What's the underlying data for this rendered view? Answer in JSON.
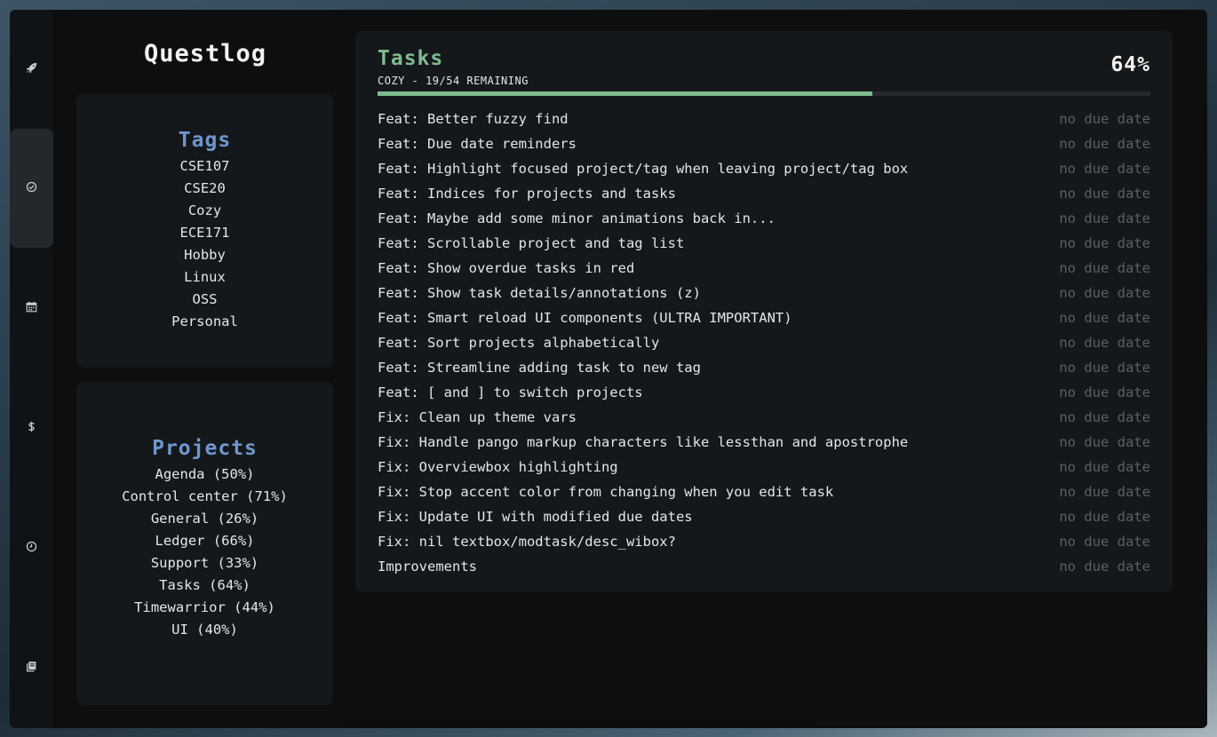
{
  "app": {
    "title": "Questlog"
  },
  "sidebar": {
    "items": [
      {
        "icon": "rocket-icon"
      },
      {
        "icon": "check-circle-icon",
        "active": true
      },
      {
        "icon": "calendar-icon"
      },
      {
        "icon": "dollar-icon"
      },
      {
        "icon": "clock-icon"
      },
      {
        "icon": "journal-icon"
      }
    ]
  },
  "tags": {
    "heading": "Tags",
    "items": [
      "CSE107",
      "CSE20",
      "Cozy",
      "ECE171",
      "Hobby",
      "Linux",
      "OSS",
      "Personal"
    ]
  },
  "projects": {
    "heading": "Projects",
    "items": [
      "Agenda (50%)",
      "Control center (71%)",
      "General (26%)",
      "Ledger (66%)",
      "Support (33%)",
      "Tasks (64%)",
      "Timewarrior (44%)",
      "UI (40%)"
    ]
  },
  "tasks": {
    "title": "Tasks",
    "subtitle": "COZY - 19/54 REMAINING",
    "percent_label": "64%",
    "progress": 0.64,
    "items": [
      {
        "desc": "Feat: Better fuzzy find",
        "due": "no due date"
      },
      {
        "desc": "Feat: Due date reminders",
        "due": "no due date"
      },
      {
        "desc": "Feat: Highlight focused project/tag when leaving project/tag box",
        "due": "no due date"
      },
      {
        "desc": "Feat: Indices for projects and tasks",
        "due": "no due date"
      },
      {
        "desc": "Feat: Maybe add some minor animations back in...",
        "due": "no due date"
      },
      {
        "desc": "Feat: Scrollable project and tag list",
        "due": "no due date"
      },
      {
        "desc": "Feat: Show overdue tasks in red",
        "due": "no due date"
      },
      {
        "desc": "Feat: Show task details/annotations (z)",
        "due": "no due date"
      },
      {
        "desc": "Feat: Smart reload UI components (ULTRA IMPORTANT)",
        "due": "no due date"
      },
      {
        "desc": "Feat: Sort projects alphabetically",
        "due": "no due date"
      },
      {
        "desc": "Feat: Streamline adding task to new tag",
        "due": "no due date"
      },
      {
        "desc": "Feat: [ and ] to switch projects",
        "due": "no due date"
      },
      {
        "desc": "Fix: Clean up theme vars",
        "due": "no due date"
      },
      {
        "desc": "Fix: Handle pango markup characters like lessthan and apostrophe",
        "due": "no due date"
      },
      {
        "desc": "Fix: Overviewbox highlighting",
        "due": "no due date"
      },
      {
        "desc": "Fix: Stop accent color from changing when you edit task",
        "due": "no due date"
      },
      {
        "desc": "Fix: Update UI with modified due dates",
        "due": "no due date"
      },
      {
        "desc": "Fix: nil textbox/modtask/desc_wibox?",
        "due": "no due date"
      },
      {
        "desc": "Improvements",
        "due": "no due date"
      }
    ]
  }
}
